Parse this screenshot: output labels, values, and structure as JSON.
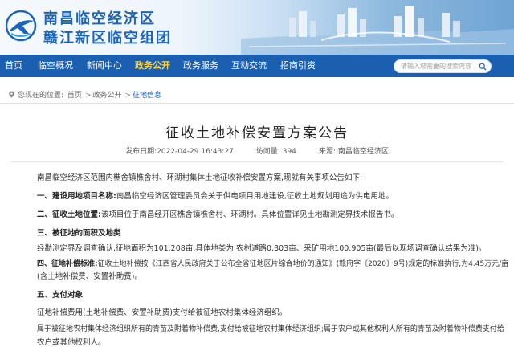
{
  "header": {
    "title_line1": "南昌临空经济区",
    "title_line2": "赣江新区临空组团",
    "logo": "airport-logo-icon"
  },
  "nav": {
    "items": [
      {
        "label": "首页"
      },
      {
        "label": "临空概况"
      },
      {
        "label": "新闻中心"
      },
      {
        "label": "政务公开"
      },
      {
        "label": "政务服务"
      },
      {
        "label": "互动交流"
      },
      {
        "label": "招商引资"
      }
    ],
    "active": "政务公开",
    "search_placeholder": "请输入您需要的搜索内容",
    "colors": {
      "bar": "#1a5fb0",
      "active": "#ffd23c"
    }
  },
  "breadcrumb": {
    "prefix": "您现在的位置:",
    "items": [
      "首页",
      "政务公开",
      "征地信息"
    ],
    "separator": ">"
  },
  "article": {
    "title": "征收土地补偿安置方案公告",
    "publish_label": "发布日期:",
    "publish_time": "2022-04-29 16:43:27",
    "views_label": "访问量:",
    "views": "394",
    "source_label": "来源:",
    "source": "南昌临空经济区",
    "intro": "南昌临空经济区范围内樵舍镇樵舍村、环湖村集体土地征收补偿安置方案,现就有关事项公告如下:",
    "s1_head": "一、建设用地项目名称:",
    "s1_body": "南昌临空经济区管理委员会关于供电项目用地建设,征收土地规划用途为供电用地。",
    "s2_head": "二、征收土地位置:",
    "s2_body": "该项目位于南昌经开区樵舍镇樵舍村、环湖村。具体位置详见土地勘测定界技术报告书。",
    "s3_head": "三、被征地的面积及地类",
    "s3_body": "经勘测定界及调查确认,征地面积为101.208亩,具体地类为:农村道路0.303亩、采矿用地100.905亩(最后以现场调查确认结果为准)。",
    "s4_head": "四、征地补偿标准:",
    "s4_body_a": "征收土地补偿按《江西省人民政府关于公布全省征地区片综合地价的通知》(赣府字〔2020〕9号)规定的标准执行,为4.45万元/亩",
    "s4_body_b": "(含土地补偿费、安置补助费)。",
    "s5_head": "五、支付对象",
    "s5_body": "征地补偿费用(土地补偿费、安置补助费)支付给被征地农村集体经济组织。",
    "s6_body_a": "属于被征地农村集体经济组织所有的青苗及附着物补偿费,支付给被征地农村集体经济组织;属于农户或其他权利人所有的青苗及附着物补偿费支付给",
    "s6_body_b": "农户或其他权利人。"
  }
}
